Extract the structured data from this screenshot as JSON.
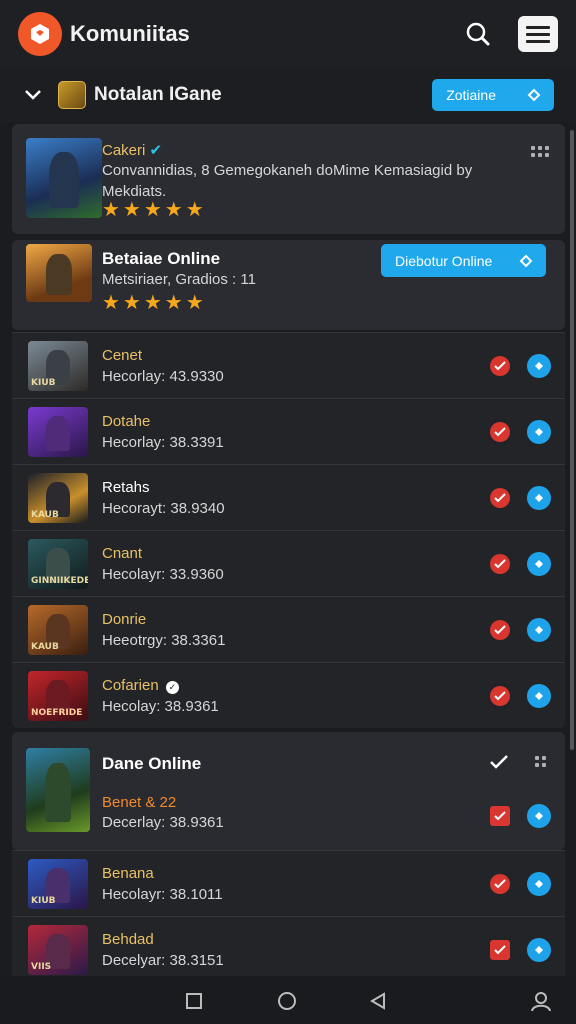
{
  "app": {
    "title": "Komuniitas",
    "colors": {
      "brand": "#f0582a",
      "accent": "#1fa8ec",
      "star": "#f6a81c",
      "check": "#d8362f"
    }
  },
  "subheader": {
    "title": "Notalan IGane",
    "button_label": "Zotiaine"
  },
  "featured": [
    {
      "name": "Cakeri",
      "description": "Convannidias, 8 Gemegokaneh doMime Kemasiagid by Mekdiats.",
      "rating": 5,
      "icon": "joystick-image"
    },
    {
      "name": "Betaiae Online",
      "description": "Metsiriaer, Gradios : 11",
      "rating": 5,
      "button_label": "Diebotur Online",
      "icon": "warrior-image"
    }
  ],
  "list_top": [
    {
      "name": "Cenet",
      "detail": "Hecorlay: 43.9330",
      "tag": "KIUB"
    },
    {
      "name": "Dotahe",
      "detail": "Hecorlay: 38.3391",
      "tag": ""
    },
    {
      "name": "Retahs",
      "detail": "Hecorayt: 38.9340",
      "tag": "KAUB",
      "white": true
    },
    {
      "name": "Cnant",
      "detail": "Hecolayr: 33.9360",
      "tag": "GINNIIKEDE"
    },
    {
      "name": "Donrie",
      "detail": "Heeotrgy: 38.3361",
      "tag": "KAUB"
    },
    {
      "name": "Cofarien",
      "detail": "Hecolay: 38.9361",
      "tag": "NOEFRIDE",
      "badge": true
    }
  ],
  "group": {
    "title": "Dane Online",
    "first": {
      "name": "Benet & 22",
      "detail": "Decerlay: 38.9361"
    },
    "items": [
      {
        "name": "Benana",
        "detail": "Hecolayr: 38.1011",
        "tag": "KIUB"
      },
      {
        "name": "Behdad",
        "detail": "Decelyar: 38.3151",
        "tag": "VIIS"
      }
    ]
  }
}
